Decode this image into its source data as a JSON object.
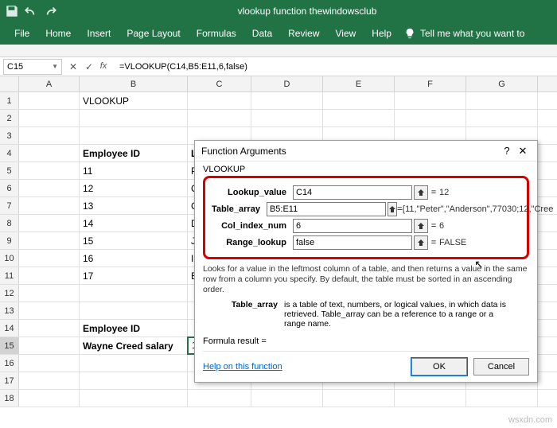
{
  "titlebar": {
    "title": "vlookup function thewindowsclub"
  },
  "menubar": {
    "tabs": [
      "File",
      "Home",
      "Insert",
      "Page Layout",
      "Formulas",
      "Data",
      "Review",
      "View",
      "Help"
    ],
    "tell": "Tell me what you want to"
  },
  "namebox": "C15",
  "formula": "=VLOOKUP(C14,B5:E11,6,false)",
  "cols": [
    "A",
    "B",
    "C",
    "D",
    "E",
    "F",
    "G"
  ],
  "rows": {
    "1": {
      "B": "VLOOKUP"
    },
    "4": {
      "B": "Employee ID",
      "C": "La"
    },
    "5": {
      "B": "11",
      "C": "P"
    },
    "6": {
      "B": "12",
      "C": "C"
    },
    "7": {
      "B": "13",
      "C": "C"
    },
    "8": {
      "B": "14",
      "C": "D"
    },
    "9": {
      "B": "15",
      "C": "Je"
    },
    "10": {
      "B": "16",
      "C": "Il"
    },
    "11": {
      "B": "17",
      "C": "B"
    },
    "14": {
      "B": "Employee ID",
      "C": "12"
    },
    "15": {
      "B": "Wayne Creed salary",
      "C": "1,6,false)"
    }
  },
  "dialog": {
    "title": "Function Arguments",
    "help": "?",
    "close": "✕",
    "fn": "VLOOKUP",
    "args": [
      {
        "label": "Lookup_value",
        "value": "C14",
        "result": "12"
      },
      {
        "label": "Table_array",
        "value": "B5:E11",
        "result": "{11,\"Peter\",\"Anderson\",77030;12,\"Cree"
      },
      {
        "label": "Col_index_num",
        "value": "6",
        "result": "6"
      },
      {
        "label": "Range_lookup",
        "value": "false",
        "result": "FALSE"
      }
    ],
    "desc": "Looks for a value in the leftmost column of a table, and then returns a value in the same row from a column you specify. By default, the table must be sorted in an ascending order.",
    "arg_name": "Table_array",
    "arg_desc": "is a table of text, numbers, or logical values, in which data is retrieved. Table_array can be a reference to a range or a range name.",
    "formula_result_label": "Formula result =",
    "help_link": "Help on this function",
    "ok": "OK",
    "cancel": "Cancel"
  },
  "watermark": "wsxdn.com"
}
